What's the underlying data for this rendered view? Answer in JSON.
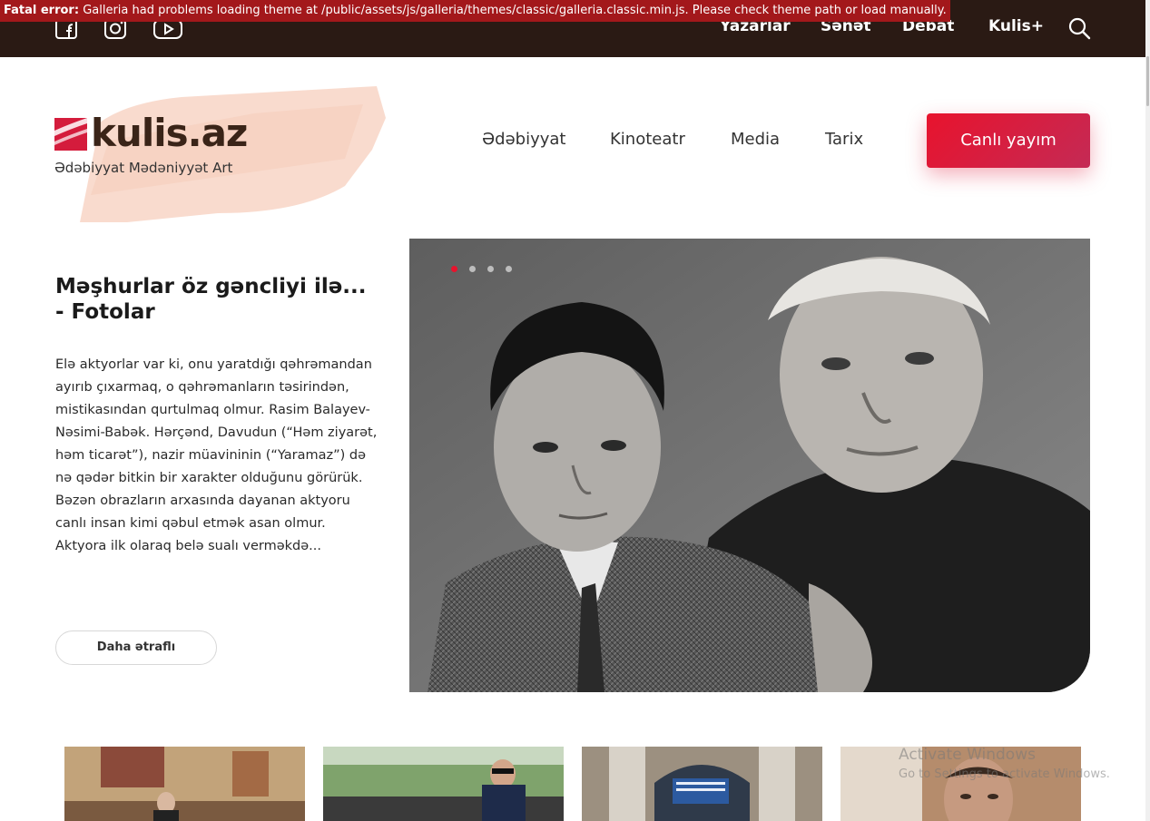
{
  "error_banner": {
    "label": "Fatal error:",
    "message": "Galleria had problems loading theme at /public/assets/js/galleria/themes/classic/galleria.classic.min.js. Please check theme path or load manually."
  },
  "social": [
    "facebook-icon",
    "instagram-icon",
    "youtube-icon"
  ],
  "top_nav": [
    "Yazarlar",
    "Sənət",
    "Debat",
    "Kulis+"
  ],
  "logo": {
    "name": "kulis.az",
    "tagline": "Ədəbiyyat Mədəniyyət Art"
  },
  "main_nav": [
    "Ədəbiyyat",
    "Kinoteatr",
    "Media",
    "Tarix"
  ],
  "live_button": "Canlı yayım",
  "hero": {
    "title": "Məşhurlar öz gəncliyi ilə... - Fotolar",
    "excerpt": "Elə aktyorlar var ki, onu yaratdığı qəhrəmandan ayırıb çıxarmaq, o qəhrəmanların təsirindən, mistikasından qurtulmaq olmur. Rasim Balayev-Nəsimi-Babək. Hərçənd, Davudun (“Həm ziyarət, həm ticarət”), nazir müavininin (“Yaramaz”) də nə qədər bitkin bir xarakter olduğunu görürük. Bəzən obrazların arxasında dayanan aktyoru canlı insan kimi qəbul etmək asan olmur. Aktyora ilk olaraq belə sualı verməkdə...",
    "more_button": "Daha ətraflı",
    "slide_count": 4,
    "active_slide": 1
  },
  "watermark": {
    "line1": "Activate Windows",
    "line2": "Go to Settings to activate Windows."
  },
  "colors": {
    "topbar": "#2a1a14",
    "accent": "#e8132d",
    "error": "#a3181b"
  }
}
